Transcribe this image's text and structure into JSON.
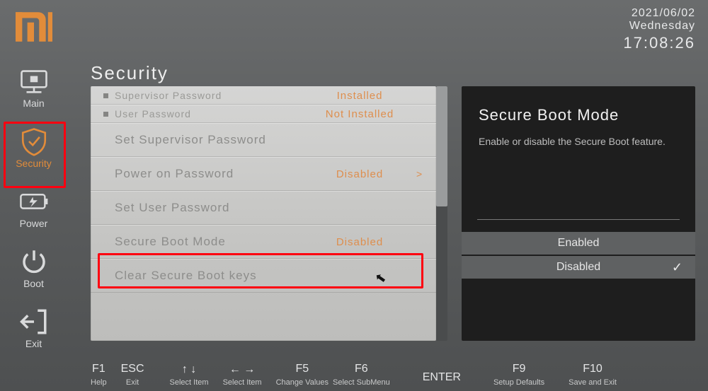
{
  "brand": "mi",
  "clock": {
    "date": "2021/06/02",
    "day": "Wednesday",
    "time": "17:08:26"
  },
  "sidebar": {
    "items": [
      {
        "id": "main",
        "label": "Main"
      },
      {
        "id": "security",
        "label": "Security"
      },
      {
        "id": "power",
        "label": "Power"
      },
      {
        "id": "boot",
        "label": "Boot"
      },
      {
        "id": "exit",
        "label": "Exit"
      }
    ],
    "active": "security"
  },
  "page": {
    "title": "Security"
  },
  "settings": {
    "items": [
      {
        "kind": "status",
        "label": "Supervisor Password",
        "value": "Installed"
      },
      {
        "kind": "status",
        "label": "User Password",
        "value": "Not Installed"
      },
      {
        "kind": "action",
        "label": "Set Supervisor Password"
      },
      {
        "kind": "select",
        "label": "Power on Password",
        "value": "Disabled",
        "arrow": true
      },
      {
        "kind": "action",
        "label": "Set User Password"
      },
      {
        "kind": "select",
        "label": "Secure Boot Mode",
        "value": "Disabled"
      },
      {
        "kind": "action",
        "label": "Clear Secure Boot keys"
      }
    ],
    "highlight_index": 5
  },
  "detail": {
    "title": "Secure Boot Mode",
    "description": "Enable or disable the Secure Boot feature.",
    "options": [
      {
        "label": "Enabled",
        "selected": false
      },
      {
        "label": "Disabled",
        "selected": true
      }
    ]
  },
  "footer": [
    {
      "key": "F1",
      "desc": "Help"
    },
    {
      "key": "ESC",
      "desc": "Exit"
    },
    {
      "icon": "↑ ↓",
      "desc": "Select Item"
    },
    {
      "icon": "← →",
      "desc": "Select Item"
    },
    {
      "key": "F5",
      "desc": "Change Values"
    },
    {
      "key": "F6",
      "desc": "Select SubMenu"
    },
    {
      "key": "ENTER",
      "desc": ""
    },
    {
      "key": "F9",
      "desc": "Setup Defaults"
    },
    {
      "key": "F10",
      "desc": "Save and Exit"
    }
  ],
  "colors": {
    "accent": "#e28c3a",
    "highlight": "#ff0010"
  }
}
